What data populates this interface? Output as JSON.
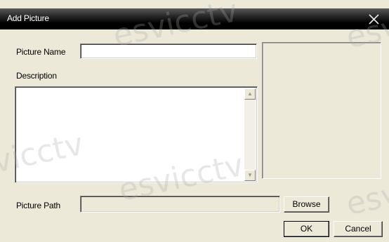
{
  "window": {
    "title": "Add Picture",
    "close_icon": "close-x-icon"
  },
  "form": {
    "name_label": "Picture Name",
    "name_value": "",
    "description_label": "Description",
    "description_value": "",
    "path_label": "Picture Path",
    "path_value": ""
  },
  "buttons": {
    "browse": "Browse",
    "ok": "OK",
    "cancel": "Cancel"
  },
  "watermark": "esvicctv",
  "colors": {
    "dialog_bg": "#ece9d8",
    "title_bar": "#000000",
    "title_text": "#ffffff"
  }
}
